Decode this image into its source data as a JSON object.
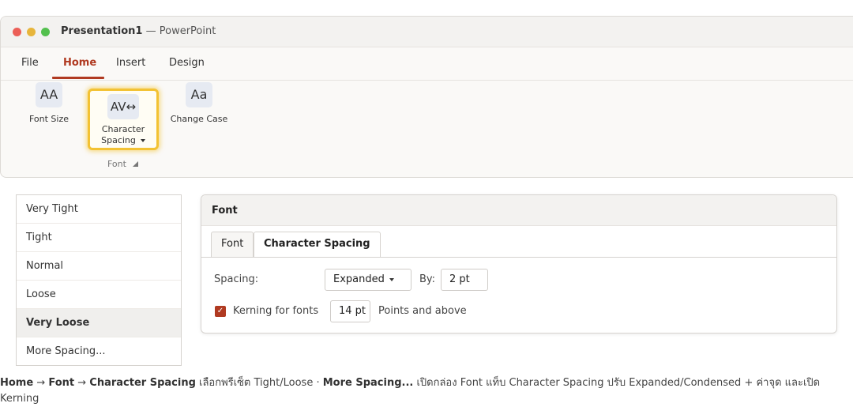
{
  "window": {
    "title_doc": "Presentation1",
    "title_sep": " — ",
    "title_app": "PowerPoint"
  },
  "tabs": [
    "File",
    "Home",
    "Insert",
    "Design"
  ],
  "ribbon": {
    "font_size": {
      "icon": "AA",
      "label": "Font Size"
    },
    "char_spacing": {
      "icon": "AV↔",
      "label1": "Character",
      "label2": "Spacing"
    },
    "change_case": {
      "icon": "Aa",
      "label": "Change Case"
    },
    "group_label": "Font"
  },
  "dropdown": {
    "items": [
      "Very Tight",
      "Tight",
      "Normal",
      "Loose",
      "Very Loose",
      "More Spacing..."
    ],
    "selected": "Very Loose"
  },
  "dialog": {
    "title": "Font",
    "tabs": [
      "Font",
      "Character Spacing"
    ],
    "active_tab": "Character Spacing",
    "spacing_label": "Spacing:",
    "spacing_value": "Expanded",
    "by_label": "By:",
    "by_value": "2 pt",
    "kerning_label": "Kerning for fonts",
    "kerning_checked": true,
    "kerning_value": "14 pt",
    "kerning_suffix": "Points and above"
  },
  "caption": {
    "p1": "Home",
    "arrow": " → ",
    "p2": "Font",
    "p3": "Character Spacing",
    "t1": " เลือกพรีเซ็ต Tight/Loose  ·  ",
    "p4": "More Spacing...",
    "t2": " เปิดกล่อง Font แท็บ Character Spacing ปรับ Expanded/Condensed + ค่าจุด และเปิด Kerning"
  },
  "colors": {
    "accent": "#b03a21",
    "highlight": "#f3c233"
  }
}
